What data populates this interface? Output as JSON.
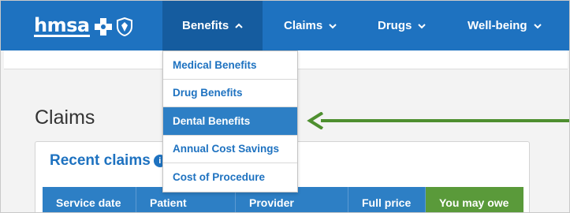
{
  "logo": {
    "text": "hmsa"
  },
  "nav": {
    "items": [
      {
        "label": "Benefits",
        "state": "open"
      },
      {
        "label": "Claims",
        "state": "closed"
      },
      {
        "label": "Drugs",
        "state": "closed"
      },
      {
        "label": "Well-being",
        "state": "closed"
      }
    ]
  },
  "dropdown": {
    "items": [
      {
        "label": "Medical Benefits"
      },
      {
        "label": "Drug Benefits"
      },
      {
        "label": "Dental Benefits",
        "highlighted": true
      },
      {
        "label": "Annual Cost Savings"
      },
      {
        "label": "Cost of Procedure"
      }
    ]
  },
  "page": {
    "title": "Claims"
  },
  "recent_claims": {
    "title": "Recent claims",
    "info_icon": "i",
    "columns": [
      "Service date",
      "Patient",
      "Provider",
      "Full price",
      "You may owe"
    ]
  },
  "colors": {
    "nav_bg": "#1e72c0",
    "nav_active": "#155c9f",
    "header_blue": "#2d7fc5",
    "owe_green": "#5a9a3a",
    "arrow_green": "#4e8f2f"
  },
  "icons": {
    "open_chevron": "chevron-up-icon",
    "closed_chevron": "chevron-down-icon",
    "annotation": "arrow-left-icon"
  }
}
